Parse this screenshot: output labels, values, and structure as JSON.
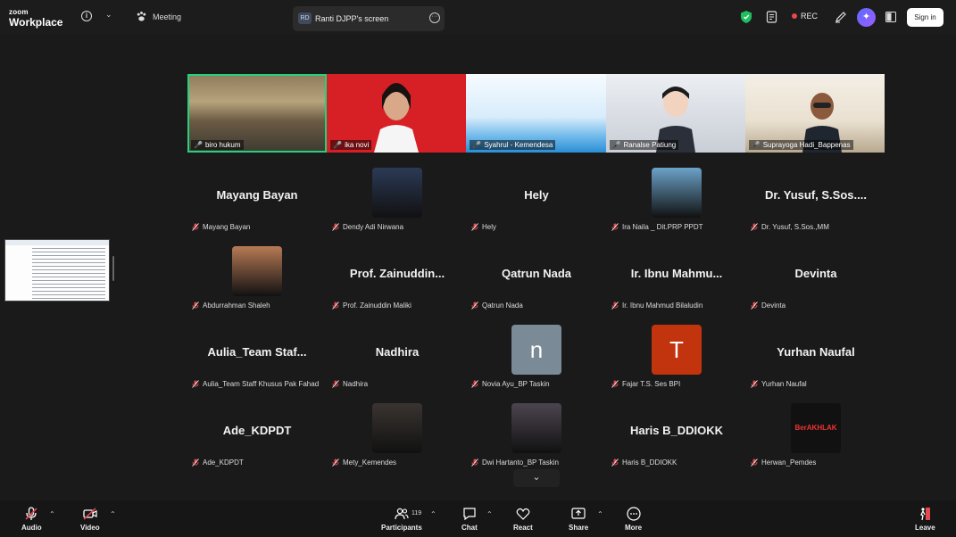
{
  "header": {
    "logo_line1": "zoom",
    "logo_line2": "Workplace",
    "meeting_label": "Meeting",
    "share_initials": "RD",
    "share_title": "Ranti DJPP's screen",
    "rec_label": "REC",
    "signin_label": "Sign in"
  },
  "strip": [
    {
      "name": "biro hukum"
    },
    {
      "name": "ika novi"
    },
    {
      "name": "Syahrul - Kemendesa"
    },
    {
      "name": "Ranalse Patiung"
    },
    {
      "name": "Suprayoga Hadi_Bappenas"
    }
  ],
  "grid": [
    {
      "display": "Mayang Bayan",
      "name": "Mayang Bayan",
      "type": "text"
    },
    {
      "display": "",
      "name": "Dendy Adi Nirwana",
      "type": "photo",
      "color": "#2b3a55"
    },
    {
      "display": "Hely",
      "name": "Hely",
      "type": "text"
    },
    {
      "display": "",
      "name": "Ira Naila _ Dit.PRP PPDT",
      "type": "photo",
      "color": "#6ba2c9"
    },
    {
      "display": "Dr. Yusuf, S.Sos....",
      "name": "Dr. Yusuf, S.Sos.,MM",
      "type": "text"
    },
    {
      "display": "",
      "name": "Abdurrahman Shaleh",
      "type": "photo",
      "color": "#b77a55"
    },
    {
      "display": "Prof. Zainuddin...",
      "name": "Prof. Zainuddin Maliki",
      "type": "text"
    },
    {
      "display": "Qatrun Nada",
      "name": "Qatrun Nada",
      "type": "text"
    },
    {
      "display": "Ir. Ibnu Mahmu...",
      "name": "Ir. Ibnu Mahmud Bilaludin",
      "type": "text"
    },
    {
      "display": "Devinta",
      "name": "Devinta",
      "type": "text"
    },
    {
      "display": "Aulia_Team Staf...",
      "name": "Aulia_Team Staff Khusus Pak Fahad",
      "type": "text"
    },
    {
      "display": "Nadhira",
      "name": "Nadhira",
      "type": "text"
    },
    {
      "display": "n",
      "name": "Novia Ayu_BP Taskin",
      "type": "letter",
      "color": "#7a8a96"
    },
    {
      "display": "T",
      "name": "Fajar T.S. Ses BPI",
      "type": "letter",
      "color": "#c2340e"
    },
    {
      "display": "Yurhan Naufal",
      "name": "Yurhan Naufal",
      "type": "text"
    },
    {
      "display": "Ade_KDPDT",
      "name": "Ade_KDPDT",
      "type": "text"
    },
    {
      "display": "",
      "name": "Mety_Kemendes",
      "type": "photo",
      "color": "#3a3431"
    },
    {
      "display": "",
      "name": "Dwi Hartanto_BP Taskin",
      "type": "photo",
      "color": "#4c4550"
    },
    {
      "display": "Haris B_DDIOKK",
      "name": "Haris B_DDIOKK",
      "type": "text"
    },
    {
      "display": "BerAKHLAK",
      "name": "Herwan_Pemdes",
      "type": "badge",
      "color": "#111111"
    }
  ],
  "toolbar": {
    "audio": "Audio",
    "video": "Video",
    "participants": "Participants",
    "participants_count": "119",
    "chat": "Chat",
    "react": "React",
    "share": "Share",
    "more": "More",
    "leave": "Leave"
  }
}
